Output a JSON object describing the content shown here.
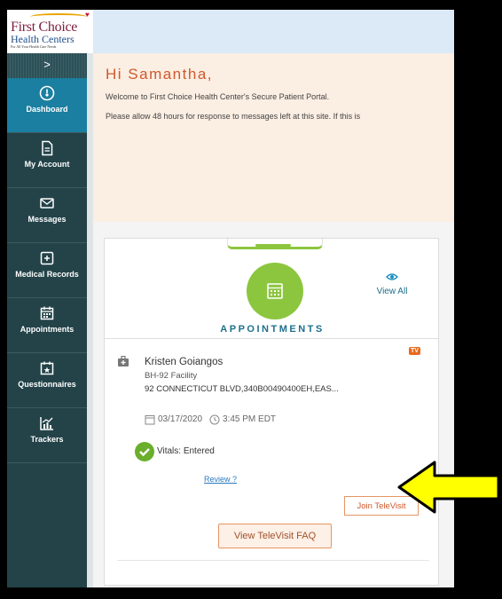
{
  "logo": {
    "line1": "First Choice",
    "line2": "Health Centers",
    "tagline": "For All Your Health Care Needs"
  },
  "sidebar": {
    "toggle_label": ">",
    "items": [
      {
        "label": "Dashboard",
        "icon": "dashboard-icon",
        "active": true
      },
      {
        "label": "My Account",
        "icon": "document-icon"
      },
      {
        "label": "Messages",
        "icon": "envelope-icon"
      },
      {
        "label": "Medical Records",
        "icon": "medical-record-icon"
      },
      {
        "label": "Appointments",
        "icon": "calendar-icon"
      },
      {
        "label": "Questionnaires",
        "icon": "star-calendar-icon"
      },
      {
        "label": "Trackers",
        "icon": "chart-icon"
      }
    ]
  },
  "welcome": {
    "greeting": "Hi Samantha,",
    "line1": "Welcome to First Choice Health Center's Secure Patient Portal.",
    "line2": "Please allow 48 hours for response to messages left at this site.  If this is"
  },
  "appointments": {
    "title": "APPOINTMENTS",
    "view_all": "View All",
    "tv_badge": "TV",
    "provider": "Kristen Goiangos",
    "facility": "BH-92 Facility",
    "address": "92 CONNECTICUT BLVD,340B00490400EH,EAS...",
    "date": "03/17/2020",
    "time": "3:45 PM EDT",
    "vitals": "Vitals: Entered",
    "review": "Review ?",
    "join_label": "Join TeleVisit",
    "faq_label": "View TeleVisit FAQ"
  },
  "colors": {
    "sidebar": "#234349",
    "active_nav": "#1a7fa0",
    "accent_green": "#8cc63f",
    "accent_orange": "#d0582b",
    "annotation_arrow": "#ffff00"
  }
}
